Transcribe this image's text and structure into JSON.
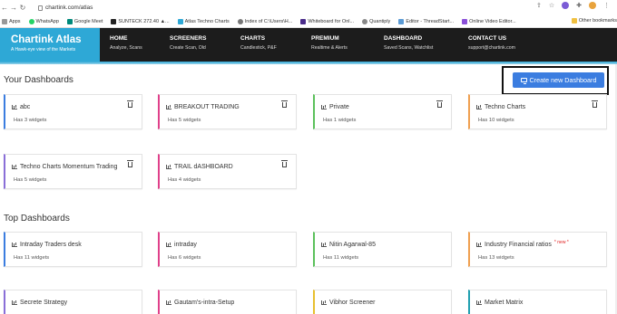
{
  "browser": {
    "url": "chartink.com/atlas",
    "bookmarks": [
      "Apps",
      "WhatsApp",
      "Google Meet",
      "SUNTECK 272.40 ▲...",
      "Atlas Techno Charts",
      "Index of C:\\Users\\H...",
      "Whiteboard for Onl...",
      "Quantiply",
      "Editor - ThreadStart...",
      "Online Video Editor..."
    ],
    "other_bookmarks": "Other bookmarks"
  },
  "header": {
    "brand": "Chartink Atlas",
    "tagline": "A Hawk-eye view of the Markets",
    "nav": [
      {
        "title": "HOME",
        "sub": "Analyze, Scans"
      },
      {
        "title": "SCREENERS",
        "sub": "Create Scan, Old"
      },
      {
        "title": "CHARTS",
        "sub": "Candlestick, P&F"
      },
      {
        "title": "PREMIUM",
        "sub": "Realtime & Alerts"
      },
      {
        "title": "DASHBOARD",
        "sub": "Saved Scans, Watchlist"
      },
      {
        "title": "CONTACT US",
        "sub": "support@chartink.com"
      }
    ]
  },
  "your_dashboards": {
    "title": "Your Dashboards",
    "create_label": "Create new Dashboard",
    "cards": [
      {
        "name": "abc",
        "widgets": "Has 3 widgets",
        "color": "#3b7de0"
      },
      {
        "name": "BREAKOUT TRADING",
        "widgets": "Has 5 widgets",
        "color": "#e0408a"
      },
      {
        "name": "Private",
        "widgets": "Has 1 widgets",
        "color": "#5cc15c"
      },
      {
        "name": "Techno Charts",
        "widgets": "Has 10 widgets",
        "color": "#f0a050"
      },
      {
        "name": "Techno Charts Momentum Trading",
        "widgets": "Has 5 widgets",
        "color": "#8a6fd8"
      },
      {
        "name": "TRAIL dASHBOARD",
        "widgets": "Has 4 widgets",
        "color": "#e0408a"
      }
    ]
  },
  "top_dashboards": {
    "title": "Top Dashboards",
    "new_badge": "* new *",
    "cards": [
      {
        "name": "Intraday Traders desk",
        "widgets": "Has 11 widgets",
        "color": "#3b7de0"
      },
      {
        "name": "intraday",
        "widgets": "Has 6 widgets",
        "color": "#e0408a"
      },
      {
        "name": "Nitin Agarwal-85",
        "widgets": "Has 11 widgets",
        "color": "#5cc15c"
      },
      {
        "name": "Industry Financial ratios",
        "widgets": "Has 13 widgets",
        "color": "#f0a050"
      },
      {
        "name": "Secrete Strategy",
        "widgets": "",
        "color": "#8a6fd8"
      },
      {
        "name": "Gautam's-intra-Setup",
        "widgets": "",
        "color": "#e0408a"
      },
      {
        "name": "Vibhor Screener",
        "widgets": "",
        "color": "#e8c030"
      },
      {
        "name": "Market Matrix",
        "widgets": "",
        "color": "#20a0b0"
      }
    ]
  }
}
